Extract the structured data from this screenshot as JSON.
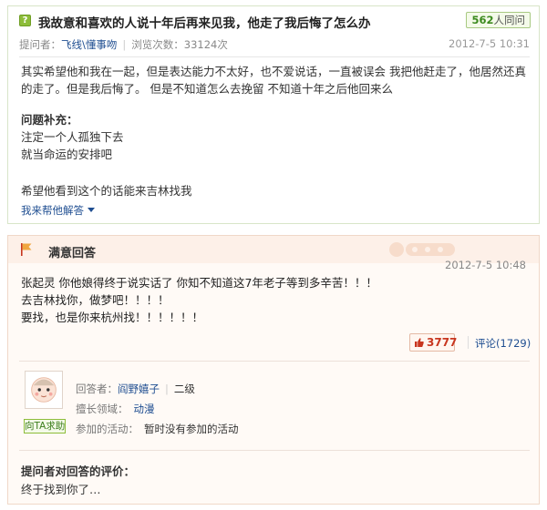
{
  "question": {
    "icon_text": "?",
    "title": "我故意和喜欢的人说十年后再来见我，他走了我后悔了怎么办",
    "same_question": {
      "count": "562",
      "suffix": "人同问"
    },
    "asker_label": "提问者：",
    "asker_name": "飞线\\懂事吻",
    "views_label": "浏览次数：",
    "views": "33124次",
    "date": "2012-7-5 10:31",
    "body": "其实希望他和我在一起，但是表达能力不太好，也不爱说话，一直被误会 我把他赶走了，他居然还真的走了。但是我后悔了。 但是不知道怎么去挽留 不知道十年之后他回来么",
    "supplement_title": "问题补充：",
    "supplement_lines": [
      "注定一个人孤独下去",
      "就当命运的安排吧",
      "希望他看到这个的话能来吉林找我"
    ],
    "help_link": "我来帮他解答"
  },
  "answer": {
    "best_label": "满意回答",
    "date": "2012-7-5 10:48",
    "lines": [
      "张起灵   你他娘得终于说实话了   你知不知道这7年老子等到多辛苦！！！",
      "去吉林找你，做梦吧！！！！",
      "要找，也是你来杭州找！！！！！！"
    ],
    "likes": "3777",
    "comments_label": "评论(1729)",
    "answerer": {
      "label": "回答者：",
      "name": "阎野嬉子",
      "level": "二级",
      "expertise_label": "擅长领域：",
      "expertise": "动漫",
      "activity_label": "参加的活动：",
      "activity": "暂时没有参加的活动",
      "ask_button": "向TA求助"
    },
    "eval_title": "提问者对回答的评价：",
    "eval_text": "终于找到你了…"
  },
  "colors": {
    "green": "#8dbd3a",
    "link": "#1f4e91",
    "like_red": "#c8361f"
  }
}
